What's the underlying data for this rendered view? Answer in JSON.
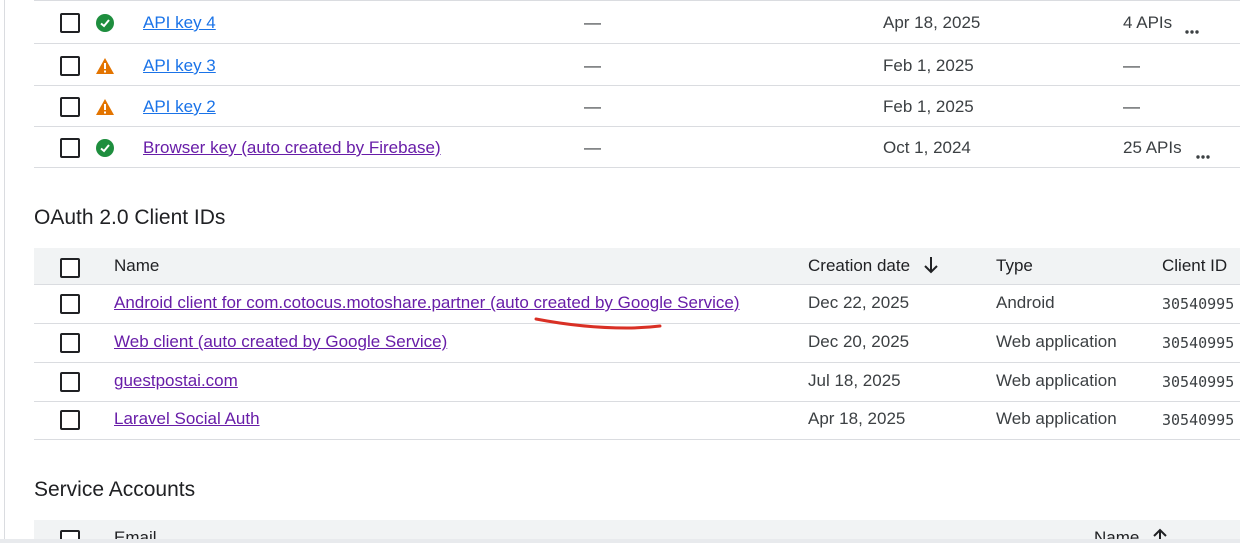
{
  "api_keys": [
    {
      "name": "API key 4",
      "status": "ok",
      "restrictions": "—",
      "created": "Apr 18, 2025",
      "apis": "4 APIs",
      "has_menu": true,
      "visited": false
    },
    {
      "name": "API key 3",
      "status": "warn",
      "restrictions": "—",
      "created": "Feb 1, 2025",
      "apis": "—",
      "has_menu": false,
      "visited": false
    },
    {
      "name": "API key 2",
      "status": "warn",
      "restrictions": "—",
      "created": "Feb 1, 2025",
      "apis": "—",
      "has_menu": false,
      "visited": false
    },
    {
      "name": "Browser key (auto created by Firebase)",
      "status": "ok",
      "restrictions": "—",
      "created": "Oct 1, 2024",
      "apis": "25 APIs",
      "has_menu": true,
      "visited": true
    }
  ],
  "oauth": {
    "title": "OAuth 2.0 Client IDs",
    "headers": {
      "name": "Name",
      "creation_date": "Creation date",
      "type": "Type",
      "client_id": "Client ID"
    },
    "rows": [
      {
        "name": "Android client for com.cotocus.motoshare.partner (auto created by Google Service)",
        "date": "Dec 22, 2025",
        "type": "Android",
        "client_id": "30540995"
      },
      {
        "name": "Web client (auto created by Google Service)",
        "date": "Dec 20, 2025",
        "type": "Web application",
        "client_id": "30540995"
      },
      {
        "name": "guestpostai.com",
        "date": "Jul 18, 2025",
        "type": "Web application",
        "client_id": "30540995"
      },
      {
        "name": "Laravel Social Auth",
        "date": "Apr 18, 2025",
        "type": "Web application",
        "client_id": "30540995"
      }
    ]
  },
  "service_accounts": {
    "title": "Service Accounts",
    "headers": {
      "email": "Email",
      "name": "Name"
    }
  },
  "colors": {
    "link": "#1a73e8",
    "visited_link": "#681da8",
    "ok": "#1e8e3e",
    "warn": "#e37400",
    "annotation": "#d93025"
  },
  "icons": {
    "ok": "check-circle-icon",
    "warn": "warning-triangle-icon",
    "menu": "more-horiz-icon",
    "sort": "arrow-down-icon"
  }
}
